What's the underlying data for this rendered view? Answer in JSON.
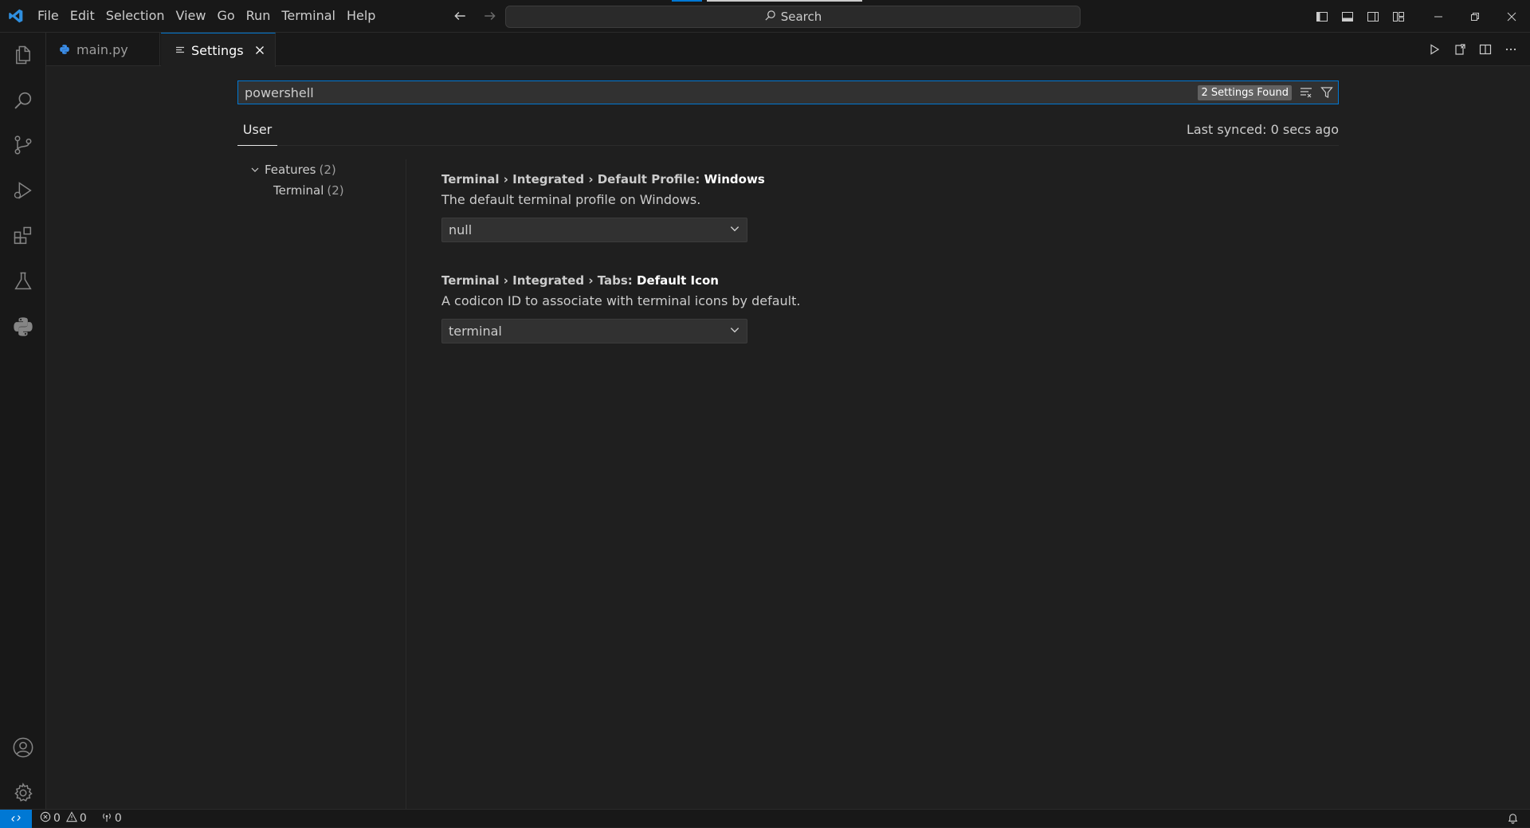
{
  "menu": [
    "File",
    "Edit",
    "Selection",
    "View",
    "Go",
    "Run",
    "Terminal",
    "Help"
  ],
  "command_center": {
    "label": "Search"
  },
  "tabs": [
    {
      "label": "main.py",
      "icon": "python-file-icon",
      "active": false
    },
    {
      "label": "Settings",
      "icon": "settings-editor-icon",
      "active": true
    }
  ],
  "settings_search": {
    "query": "powershell",
    "result_badge": "2 Settings Found"
  },
  "scope": {
    "user_tab": "User",
    "last_synced": "Last synced: 0 secs ago"
  },
  "toc": [
    {
      "label": "Features",
      "count": "(2)",
      "expanded": true
    },
    {
      "label": "Terminal",
      "count": "(2)"
    }
  ],
  "settings": [
    {
      "path": "Terminal › Integrated › Default Profile: ",
      "leaf": "Windows",
      "description": "The default terminal profile on Windows.",
      "value": "null"
    },
    {
      "path": "Terminal › Integrated › Tabs: ",
      "leaf": "Default Icon",
      "description": "A codicon ID to associate with terminal icons by default.",
      "value": "terminal"
    }
  ],
  "status": {
    "errors": "0",
    "warnings": "0",
    "ports": "0"
  },
  "colors": {
    "accent": "#0078d4",
    "background": "#1f1f1f",
    "chrome": "#181818"
  }
}
